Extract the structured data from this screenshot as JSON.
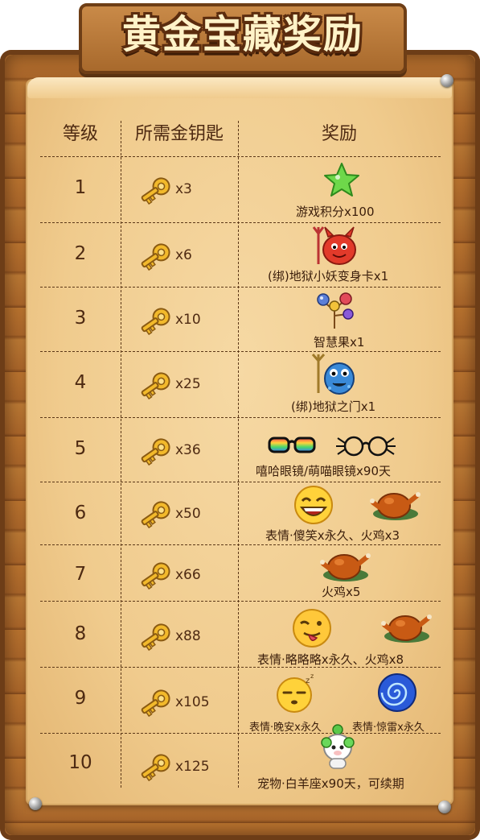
{
  "title": "黄金宝藏奖励",
  "header": {
    "level": "等级",
    "keys": "所需金钥匙",
    "reward": "奖励"
  },
  "rows": [
    {
      "level": "1",
      "keys": "x3",
      "reward": "游戏积分x100",
      "icons": [
        "star-icon"
      ]
    },
    {
      "level": "2",
      "keys": "x6",
      "reward": "(绑)地狱小妖变身卡x1",
      "icons": [
        "red-devil-icon"
      ]
    },
    {
      "level": "3",
      "keys": "x10",
      "reward": "智慧果x1",
      "icons": [
        "wisdom-fruit-icon"
      ]
    },
    {
      "level": "4",
      "keys": "x25",
      "reward": "(绑)地狱之门x1",
      "icons": [
        "blue-monster-icon"
      ]
    },
    {
      "level": "5",
      "keys": "x36",
      "reward": "嘻哈眼镜/萌喵眼镜x90天",
      "icons": [
        "hiphop-glasses-icon",
        "cat-glasses-icon"
      ]
    },
    {
      "level": "6",
      "keys": "x50",
      "reward": "表情·傻笑x永久、火鸡x3",
      "icons": [
        "laughing-face-icon",
        "roast-turkey-icon"
      ]
    },
    {
      "level": "7",
      "keys": "x66",
      "reward": "火鸡x5",
      "icons": [
        "roast-turkey-icon"
      ]
    },
    {
      "level": "8",
      "keys": "x88",
      "reward": "表情·略略略x永久、火鸡x8",
      "icons": [
        "tongue-face-icon",
        "roast-turkey-icon"
      ]
    },
    {
      "level": "9",
      "keys": "x105",
      "reward_left": "表情·晚安x永久",
      "reward_right": "表情·惊雷x永久",
      "icons": [
        "sleepy-face-icon",
        "blue-vortex-icon"
      ]
    },
    {
      "level": "10",
      "keys": "x125",
      "reward": "宠物·白羊座x90天，可续期",
      "icons": [
        "sheep-pet-icon"
      ]
    }
  ],
  "colors": {
    "wood": "#a8652a",
    "paper": "#f0cb8d",
    "ink": "#4e2a12",
    "key_gold": "#f2b92b"
  }
}
